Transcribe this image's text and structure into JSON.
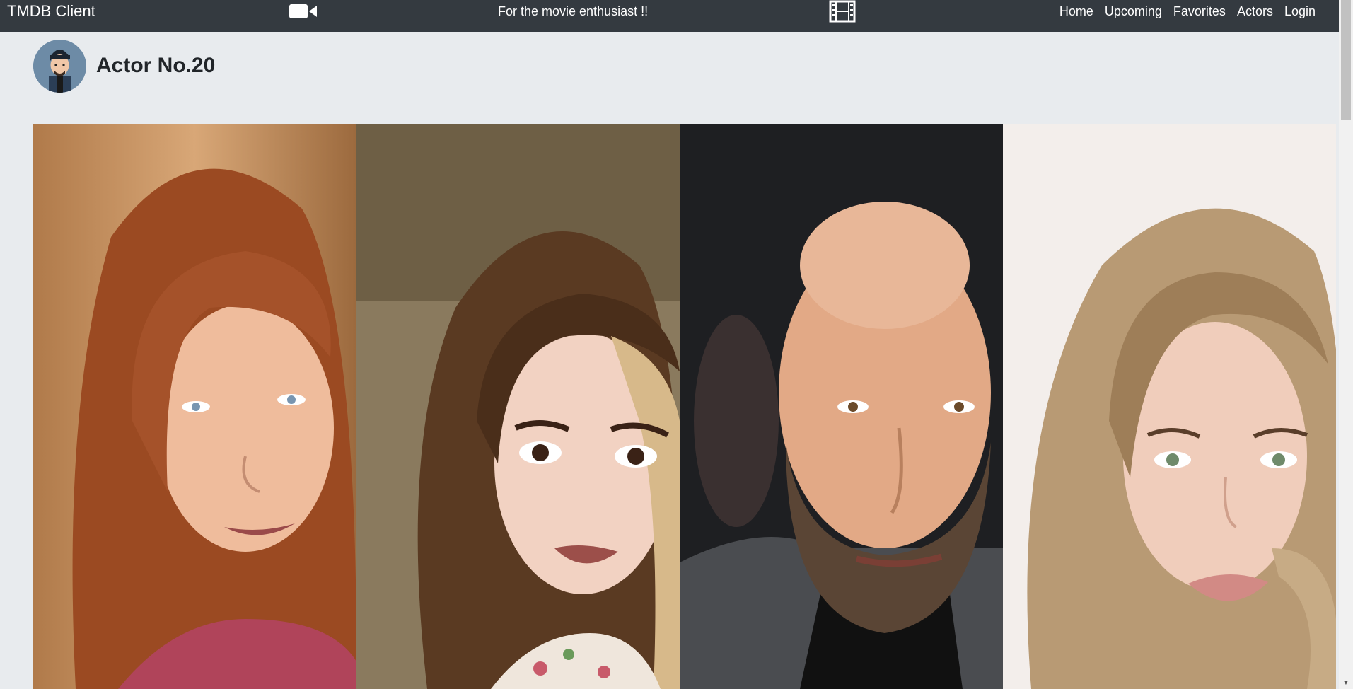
{
  "navbar": {
    "brand": "TMDB Client",
    "tagline": "For the movie enthusiast !!",
    "left_icon": "video-camera-icon",
    "right_icon": "film-icon",
    "links": [
      "Home",
      "Upcoming",
      "Favorites",
      "Actors",
      "Login"
    ],
    "background": "#343a40"
  },
  "page": {
    "background": "#e8ebee",
    "actor_title": "Actor No.20",
    "avatar_icon": "cartoon-man-avatar"
  },
  "photos": [
    {
      "description_icon": "actor-photo-red-hair-woman"
    },
    {
      "description_icon": "actor-photo-blonde-woman"
    },
    {
      "description_icon": "actor-photo-bald-man"
    },
    {
      "description_icon": "actor-photo-blonde-woman-2"
    }
  ]
}
